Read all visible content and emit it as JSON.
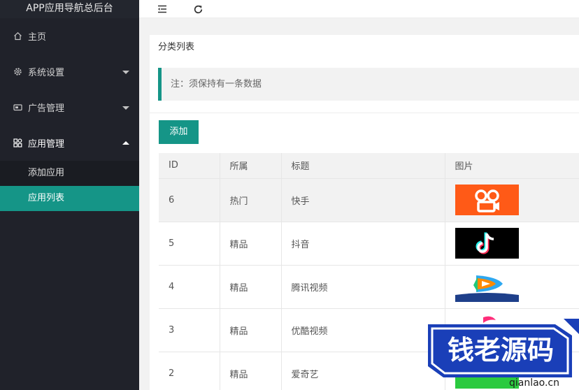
{
  "app": {
    "title": "APP应用导航总后台"
  },
  "sidebar": {
    "items": [
      {
        "label": "主页",
        "icon": "home-icon",
        "expandable": false
      },
      {
        "label": "系统设置",
        "icon": "gear-icon",
        "expandable": true,
        "expanded": false
      },
      {
        "label": "广告管理",
        "icon": "ad-icon",
        "expandable": true,
        "expanded": false
      },
      {
        "label": "应用管理",
        "icon": "apps-icon",
        "expandable": true,
        "expanded": true
      }
    ],
    "subitems": [
      {
        "label": "添加应用",
        "active": false
      },
      {
        "label": "应用列表",
        "active": true
      }
    ]
  },
  "topbar": {
    "icons": [
      "menu-collapse-icon",
      "refresh-icon"
    ]
  },
  "main": {
    "card_title": "分类列表",
    "note": "注：须保持有一条数据",
    "add_label": "添加",
    "table": {
      "headers": [
        "ID",
        "所属",
        "标题",
        "图片"
      ],
      "rows": [
        {
          "id": "6",
          "category": "热门",
          "title": "快手",
          "image": "kuaishou-logo"
        },
        {
          "id": "5",
          "category": "精品",
          "title": "抖音",
          "image": "douyin-logo"
        },
        {
          "id": "4",
          "category": "精品",
          "title": "腾讯视频",
          "image": "tencent-video-logo"
        },
        {
          "id": "3",
          "category": "精品",
          "title": "优酷视频",
          "image": "youku-logo"
        },
        {
          "id": "2",
          "category": "精品",
          "title": "爱奇艺",
          "image": "iqiyi-logo"
        }
      ]
    }
  },
  "watermark": {
    "text": "钱老源码",
    "url": "qianlao.cn"
  },
  "colors": {
    "accent": "#159587",
    "sidebar_bg": "#20222a",
    "kuaishou": "#ff5a17",
    "douyin_bg": "#000000",
    "tencent_blue": "#1e5fb4"
  }
}
